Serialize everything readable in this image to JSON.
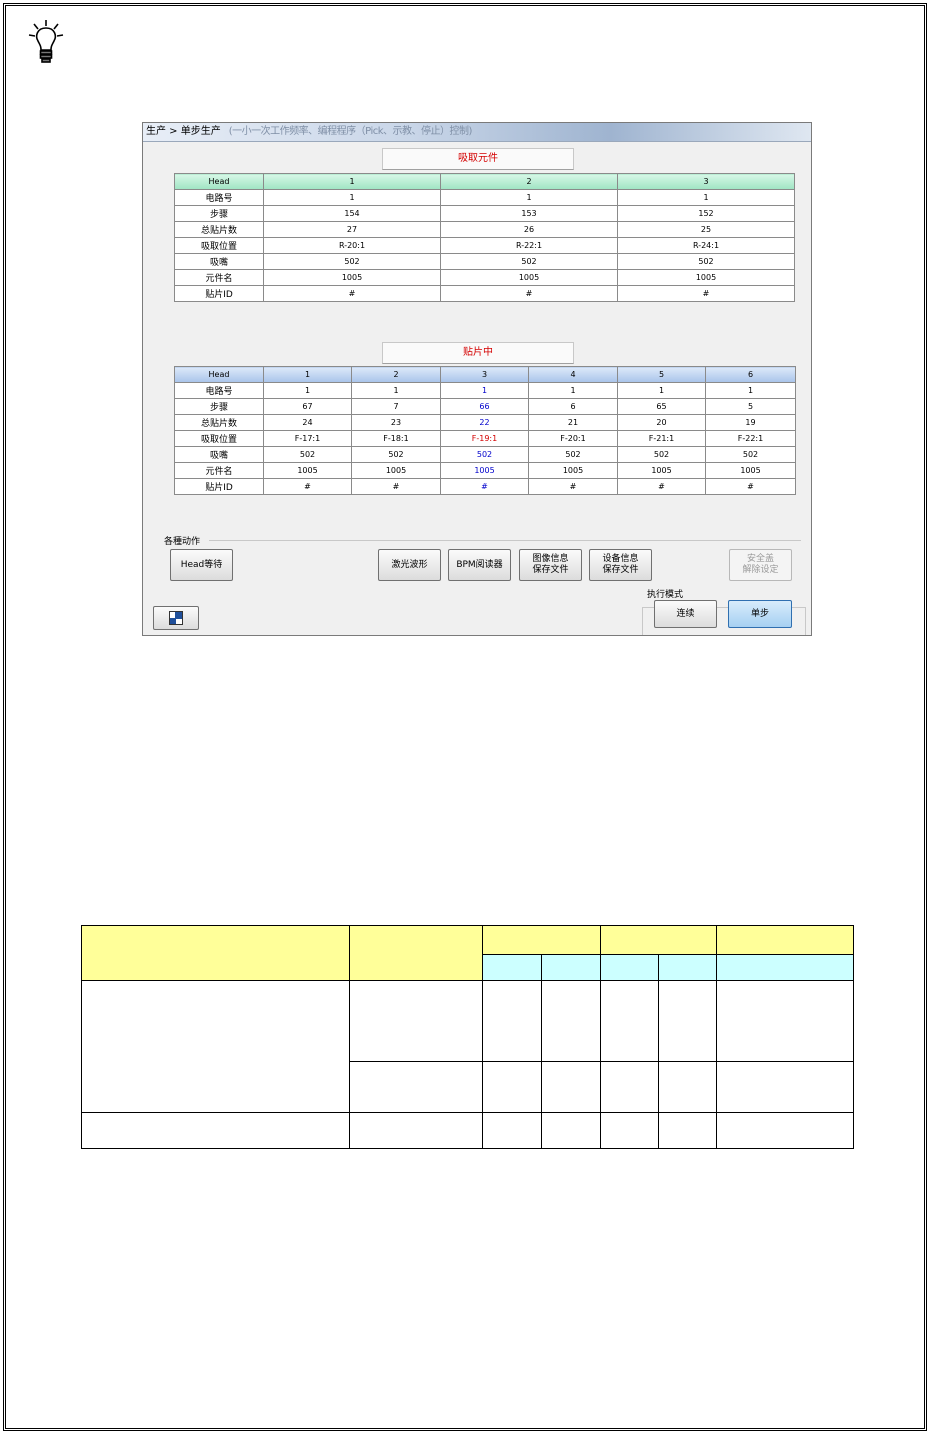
{
  "app": {
    "breadcrumb": "生产 > 单步生产",
    "breadcrumb_tail": "(一小一次工作频率、编程程序（Pick、示教、停止）控制)"
  },
  "pick_section": {
    "title": "吸取元件",
    "header": [
      "Head",
      "1",
      "2",
      "3"
    ],
    "rows": [
      [
        "电路号",
        "1",
        "1",
        "1"
      ],
      [
        "步骤",
        "154",
        "153",
        "152"
      ],
      [
        "总贴片数",
        "27",
        "26",
        "25"
      ],
      [
        "吸取位置",
        "R-20:1",
        "R-22:1",
        "R-24:1"
      ],
      [
        "吸嘴",
        "502",
        "502",
        "502"
      ],
      [
        "元件名",
        "1005",
        "1005",
        "1005"
      ],
      [
        "贴片ID",
        "#",
        "#",
        "#"
      ]
    ]
  },
  "mount_section": {
    "title": "贴片中",
    "header": [
      "Head",
      "1",
      "2",
      "3",
      "4",
      "5",
      "6"
    ],
    "rows": [
      [
        "电路号",
        "1",
        "1",
        "1",
        "1",
        "1",
        "1"
      ],
      [
        "步骤",
        "67",
        "7",
        "66",
        "6",
        "65",
        "5"
      ],
      [
        "总贴片数",
        "24",
        "23",
        "22",
        "21",
        "20",
        "19"
      ],
      [
        "吸取位置",
        "F-17:1",
        "F-18:1",
        "F-19:1",
        "F-20:1",
        "F-21:1",
        "F-22:1"
      ],
      [
        "吸嘴",
        "502",
        "502",
        "502",
        "502",
        "502",
        "502"
      ],
      [
        "元件名",
        "1005",
        "1005",
        "1005",
        "1005",
        "1005",
        "1005"
      ],
      [
        "贴片ID",
        "#",
        "#",
        "#",
        "#",
        "#",
        "#"
      ]
    ],
    "highlight_color": "#0000cc",
    "alert_color": "#d40000"
  },
  "actions": {
    "label": "各種动作",
    "head_wait": "Head等待",
    "laser_wave": "激光波形",
    "bpm_reader": "BPM阅读器",
    "image_info_save": "图像信息\n保存文件",
    "device_info_save": "设备信息\n保存文件",
    "safety_release": "安全盖\n解除设定"
  },
  "exec_mode": {
    "label": "执行模式",
    "continuous": "连续",
    "single_step": "单步"
  },
  "icons": {
    "tip": "lightbulb-icon",
    "window": "window-icon"
  },
  "colors": {
    "pick_header": "#9fe4c3",
    "mount_header": "#a9c4ea",
    "table_header_yellow": "#ffff99",
    "table_header_cyan": "#ccffff"
  }
}
